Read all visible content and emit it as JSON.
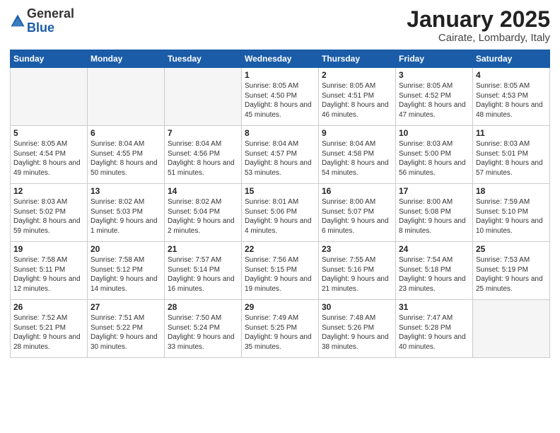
{
  "header": {
    "logo_general": "General",
    "logo_blue": "Blue",
    "month_title": "January 2025",
    "subtitle": "Cairate, Lombardy, Italy"
  },
  "weekdays": [
    "Sunday",
    "Monday",
    "Tuesday",
    "Wednesday",
    "Thursday",
    "Friday",
    "Saturday"
  ],
  "weeks": [
    [
      {
        "day": "",
        "empty": true
      },
      {
        "day": "",
        "empty": true
      },
      {
        "day": "",
        "empty": true
      },
      {
        "day": "1",
        "sunrise": "8:05 AM",
        "sunset": "4:50 PM",
        "daylight": "8 hours and 45 minutes."
      },
      {
        "day": "2",
        "sunrise": "8:05 AM",
        "sunset": "4:51 PM",
        "daylight": "8 hours and 46 minutes."
      },
      {
        "day": "3",
        "sunrise": "8:05 AM",
        "sunset": "4:52 PM",
        "daylight": "8 hours and 47 minutes."
      },
      {
        "day": "4",
        "sunrise": "8:05 AM",
        "sunset": "4:53 PM",
        "daylight": "8 hours and 48 minutes."
      }
    ],
    [
      {
        "day": "5",
        "sunrise": "8:05 AM",
        "sunset": "4:54 PM",
        "daylight": "8 hours and 49 minutes."
      },
      {
        "day": "6",
        "sunrise": "8:04 AM",
        "sunset": "4:55 PM",
        "daylight": "8 hours and 50 minutes."
      },
      {
        "day": "7",
        "sunrise": "8:04 AM",
        "sunset": "4:56 PM",
        "daylight": "8 hours and 51 minutes."
      },
      {
        "day": "8",
        "sunrise": "8:04 AM",
        "sunset": "4:57 PM",
        "daylight": "8 hours and 53 minutes."
      },
      {
        "day": "9",
        "sunrise": "8:04 AM",
        "sunset": "4:58 PM",
        "daylight": "8 hours and 54 minutes."
      },
      {
        "day": "10",
        "sunrise": "8:03 AM",
        "sunset": "5:00 PM",
        "daylight": "8 hours and 56 minutes."
      },
      {
        "day": "11",
        "sunrise": "8:03 AM",
        "sunset": "5:01 PM",
        "daylight": "8 hours and 57 minutes."
      }
    ],
    [
      {
        "day": "12",
        "sunrise": "8:03 AM",
        "sunset": "5:02 PM",
        "daylight": "8 hours and 59 minutes."
      },
      {
        "day": "13",
        "sunrise": "8:02 AM",
        "sunset": "5:03 PM",
        "daylight": "9 hours and 1 minute."
      },
      {
        "day": "14",
        "sunrise": "8:02 AM",
        "sunset": "5:04 PM",
        "daylight": "9 hours and 2 minutes."
      },
      {
        "day": "15",
        "sunrise": "8:01 AM",
        "sunset": "5:06 PM",
        "daylight": "9 hours and 4 minutes."
      },
      {
        "day": "16",
        "sunrise": "8:00 AM",
        "sunset": "5:07 PM",
        "daylight": "9 hours and 6 minutes."
      },
      {
        "day": "17",
        "sunrise": "8:00 AM",
        "sunset": "5:08 PM",
        "daylight": "9 hours and 8 minutes."
      },
      {
        "day": "18",
        "sunrise": "7:59 AM",
        "sunset": "5:10 PM",
        "daylight": "9 hours and 10 minutes."
      }
    ],
    [
      {
        "day": "19",
        "sunrise": "7:58 AM",
        "sunset": "5:11 PM",
        "daylight": "9 hours and 12 minutes."
      },
      {
        "day": "20",
        "sunrise": "7:58 AM",
        "sunset": "5:12 PM",
        "daylight": "9 hours and 14 minutes."
      },
      {
        "day": "21",
        "sunrise": "7:57 AM",
        "sunset": "5:14 PM",
        "daylight": "9 hours and 16 minutes."
      },
      {
        "day": "22",
        "sunrise": "7:56 AM",
        "sunset": "5:15 PM",
        "daylight": "9 hours and 19 minutes."
      },
      {
        "day": "23",
        "sunrise": "7:55 AM",
        "sunset": "5:16 PM",
        "daylight": "9 hours and 21 minutes."
      },
      {
        "day": "24",
        "sunrise": "7:54 AM",
        "sunset": "5:18 PM",
        "daylight": "9 hours and 23 minutes."
      },
      {
        "day": "25",
        "sunrise": "7:53 AM",
        "sunset": "5:19 PM",
        "daylight": "9 hours and 25 minutes."
      }
    ],
    [
      {
        "day": "26",
        "sunrise": "7:52 AM",
        "sunset": "5:21 PM",
        "daylight": "9 hours and 28 minutes."
      },
      {
        "day": "27",
        "sunrise": "7:51 AM",
        "sunset": "5:22 PM",
        "daylight": "9 hours and 30 minutes."
      },
      {
        "day": "28",
        "sunrise": "7:50 AM",
        "sunset": "5:24 PM",
        "daylight": "9 hours and 33 minutes."
      },
      {
        "day": "29",
        "sunrise": "7:49 AM",
        "sunset": "5:25 PM",
        "daylight": "9 hours and 35 minutes."
      },
      {
        "day": "30",
        "sunrise": "7:48 AM",
        "sunset": "5:26 PM",
        "daylight": "9 hours and 38 minutes."
      },
      {
        "day": "31",
        "sunrise": "7:47 AM",
        "sunset": "5:28 PM",
        "daylight": "9 hours and 40 minutes."
      },
      {
        "day": "",
        "empty": true
      }
    ]
  ]
}
